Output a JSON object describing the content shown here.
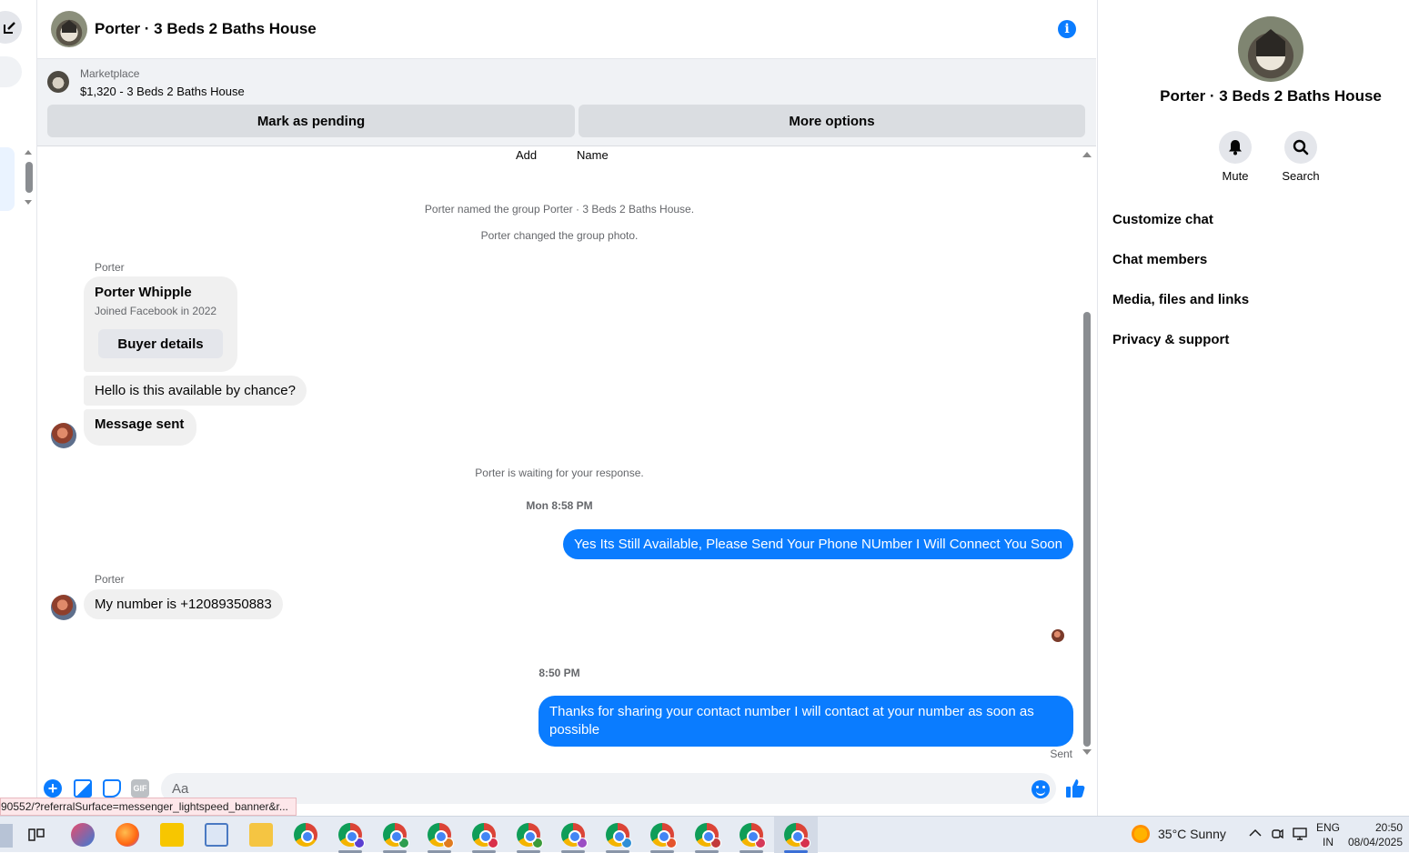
{
  "header": {
    "title": "Porter · 3 Beds 2 Baths House"
  },
  "marketplace": {
    "label": "Marketplace",
    "listing": "$1,320 - 3 Beds 2 Baths House",
    "pending_button": "Mark as pending",
    "more_button": "More options"
  },
  "messages": {
    "add_label": "Add",
    "name_label": "Name",
    "sys_named": "Porter named the group Porter · 3 Beds 2 Baths House.",
    "sys_photo": "Porter changed the group photo.",
    "sender": "Porter",
    "card": {
      "name": "Porter Whipple",
      "sub": "Joined Facebook in 2022",
      "button": "Buyer details"
    },
    "msg1": "Hello is this available by chance?",
    "msg2": "Message sent",
    "sys_waiting": "Porter is waiting for your response.",
    "time1": "Mon 8:58 PM",
    "out1": "Yes Its Still Available, Please Send Your Phone NUmber I Will Connect You Soon",
    "sender2": "Porter",
    "msg3": "My number is +12089350883",
    "time2": "8:50 PM",
    "out2": "Thanks for sharing your contact number I will contact at your number as soon as possible",
    "sent": "Sent"
  },
  "composer": {
    "placeholder": "Aa",
    "gif": "GIF",
    "plus": "+"
  },
  "status_url": "90552/?referralSurface=messenger_lightspeed_banner&r...",
  "panel": {
    "title": "Porter · 3 Beds 2 Baths House",
    "mute": "Mute",
    "search": "Search",
    "items": [
      "Customize chat",
      "Chat members",
      "Media, files and links",
      "Privacy & support"
    ]
  },
  "taskbar": {
    "weather": "35°C  Sunny",
    "lang1": "ENG",
    "lang2": "IN",
    "time": "20:50",
    "date": "08/04/2025"
  },
  "colors": {
    "accent": "#0a7cff",
    "bubble_in": "#f0f0f0",
    "panel_bg": "#f0f2f5"
  }
}
